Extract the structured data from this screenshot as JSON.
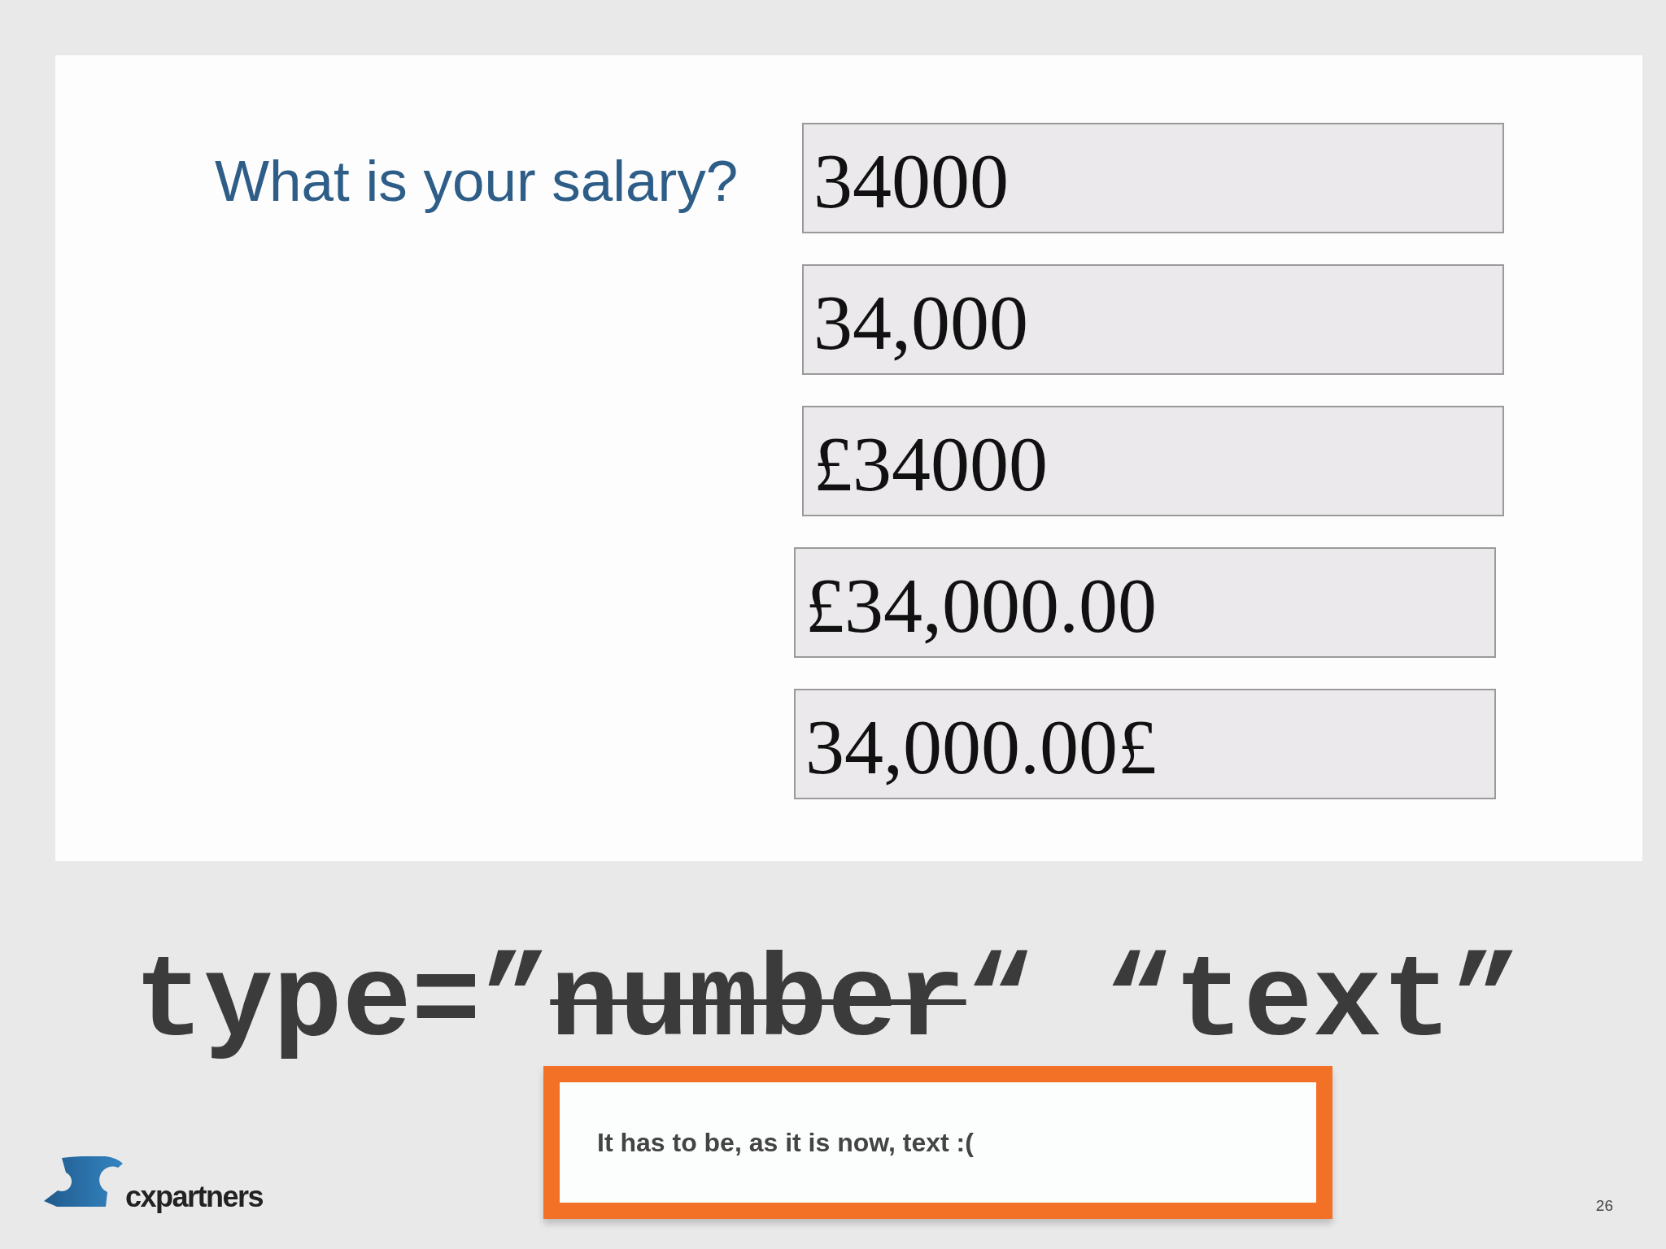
{
  "slide": {
    "question": "What is your salary?",
    "fields": [
      {
        "value": "34000"
      },
      {
        "value": "34,000"
      },
      {
        "value": "£34000"
      },
      {
        "value": "£34,000.00"
      },
      {
        "value": "34,000.00£"
      }
    ]
  },
  "code_line": [
    {
      "text": "type=”",
      "struck": false
    },
    {
      "text": "number",
      "struck": true
    },
    {
      "text": "“ “text”",
      "struck": false
    }
  ],
  "note": "It has to be, as it is now, text :(",
  "logo": {
    "wordmark": "cxpartners"
  },
  "page_number": "26"
}
